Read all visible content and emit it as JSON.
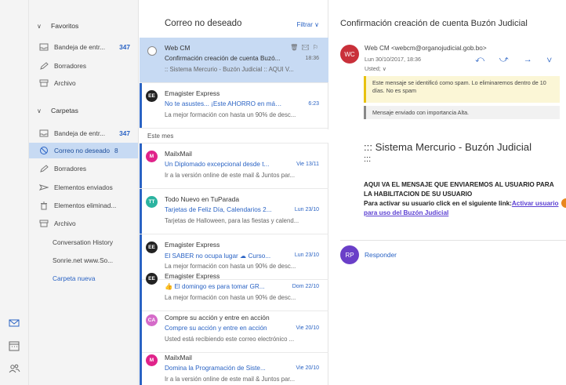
{
  "folders": {
    "favorites_label": "Favoritos",
    "favorites": [
      {
        "label": "Bandeja de entr...",
        "count": "347",
        "icon": "inbox-icon"
      },
      {
        "label": "Borradores",
        "count": "",
        "icon": "pencil-icon"
      },
      {
        "label": "Archivo",
        "count": "",
        "icon": "archive-icon"
      }
    ],
    "folders_label": "Carpetas",
    "folders": [
      {
        "label": "Bandeja de entr...",
        "count": "347",
        "icon": "inbox-icon"
      },
      {
        "label": "Correo no deseado",
        "count": "8",
        "icon": "block-icon"
      },
      {
        "label": "Borradores",
        "count": "",
        "icon": "pencil-icon"
      },
      {
        "label": "Elementos enviados",
        "count": "",
        "icon": "send-icon"
      },
      {
        "label": "Elementos eliminad...",
        "count": "",
        "icon": "trash-icon"
      },
      {
        "label": "Archivo",
        "count": "",
        "icon": "archive-icon"
      }
    ],
    "extra": [
      "Conversation History",
      "Sonrie.net www.So..."
    ],
    "new_folder": "Carpeta nueva"
  },
  "list": {
    "title": "Correo no deseado",
    "filter": "Filtrar ∨",
    "group_label": "Este mes",
    "messages": [
      {
        "sender": "Web CM",
        "subject": "Confirmación creación de cuenta Buzó...",
        "date": "18:36",
        "preview": ":: Sistema Mercurio - Buzón Judicial :: AQUI V...",
        "avatar": "",
        "icons": "🗑 ✉ ⚐"
      },
      {
        "sender": "Emagister Express",
        "subject": "No te asustes... ¡Este AHORRO en mást...",
        "date": "6:23",
        "preview": "La mejor formación con hasta un 90% de desc...",
        "avatar": "EE"
      },
      {
        "sender": "MailxMail",
        "subject": "Un Diplomado excepcional desde t...",
        "date": "Vie 13/11",
        "preview": "Ir a la versión online de este mail & Juntos par...",
        "avatar": "M"
      },
      {
        "sender": "Todo Nuevo en TuParada",
        "subject": "Tarjetas de Feliz Día, Calendarios 2...",
        "date": "Lun 23/10",
        "preview": "Tarjetas de Halloween, para las fiestas y calend...",
        "avatar": "TT"
      },
      {
        "sender": "Emagister Express",
        "subject": "El SABER no ocupa lugar ☁ Curso...",
        "date": "Lun 23/10",
        "preview": "La mejor formación con hasta un 90% de desc...",
        "avatar": "EE"
      },
      {
        "sender": "Emagister Express",
        "subject": "👍 El domingo es para tomar GR...",
        "date": "Dom 22/10",
        "preview": "La mejor formación con hasta un 90% de desc...",
        "avatar": "EE"
      },
      {
        "sender": "Compre su acción y entre en acción",
        "subject": "Compre su acción y entre en acción",
        "date": "Vie 20/10",
        "preview": "Usted está recibiendo este correo electrónico ...",
        "avatar": "CA"
      },
      {
        "sender": "MailxMail",
        "subject": "Domina la Programación de Siste...",
        "date": "Vie 20/10",
        "preview": "Ir a la versión online de este mail & Juntos par...",
        "avatar": "M"
      }
    ]
  },
  "reading": {
    "subject": "Confirmación creación de cuenta Buzón Judicial",
    "avatar": "WC",
    "from": "Web CM <webcm@organojudicial.gob.bo>",
    "date": "Lun 30/10/2017, 18:36",
    "to": "Usted; ∨",
    "actions": "⤺ ⤻ → ∨",
    "spam_notice": "Este mensaje se identificó como spam. Lo eliminaremos dentro de 10 días. No es spam",
    "importance_notice": "Mensaje enviado con importancia Alta.",
    "heading": "::: Sistema Mercurio - Buzón Judicial",
    "heading2": ":::",
    "body_line1": "AQUI VA EL MENSAJE QUE ENVIAREMOS AL USUARIO PARA LA HABILITACION DE SU USUARIO",
    "body_line2": "Para activar su usuario click en el siguiente link:",
    "body_link": "Activar usuario para uso del Buzón Judicial",
    "reply_avatar": "RP",
    "reply_label": "Responder"
  },
  "rail": {
    "icons": [
      "mail-icon",
      "calendar-icon",
      "people-icon"
    ]
  }
}
